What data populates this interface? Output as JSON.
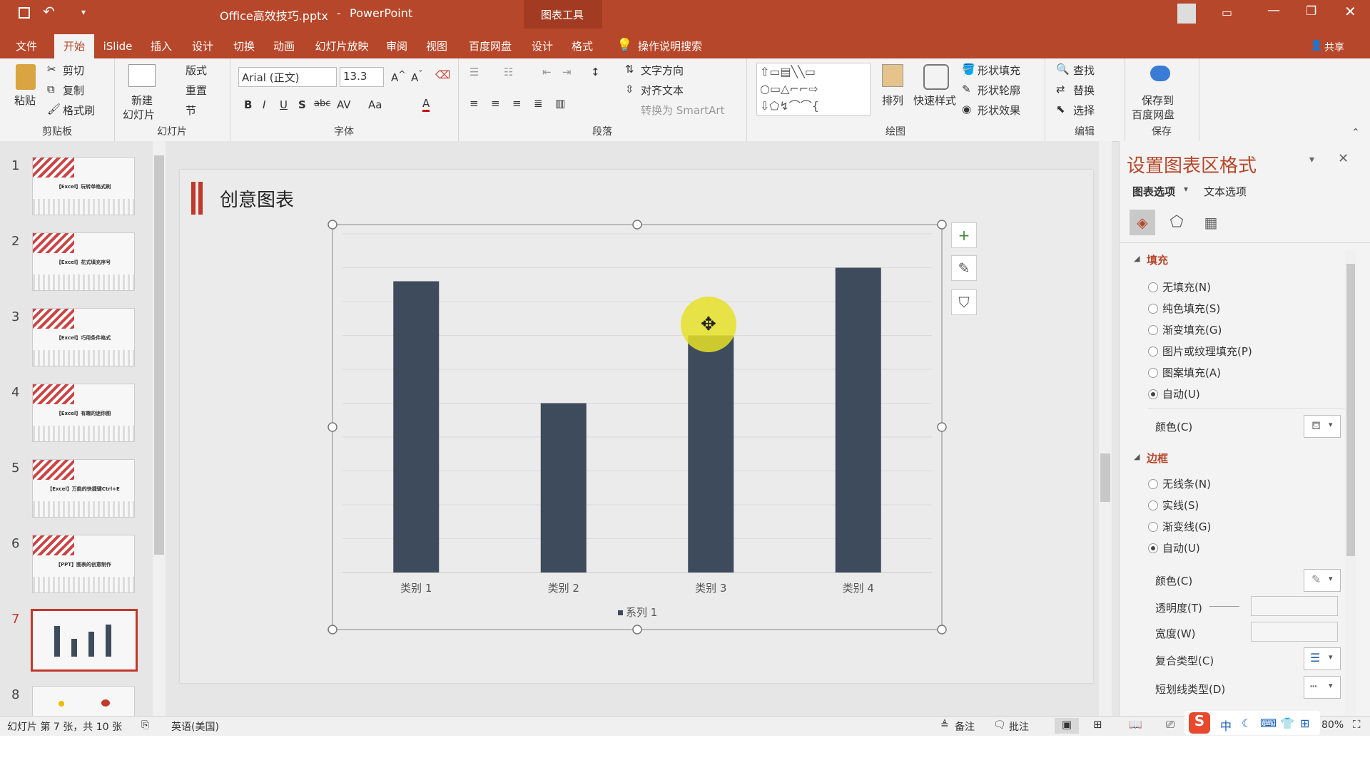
{
  "titlebar": {
    "filename": "Office高效技巧.pptx",
    "separator": "-",
    "app": "PowerPoint",
    "context_tab": "图表工具",
    "share": "共享"
  },
  "ribbon_tabs": [
    "文件",
    "开始",
    "iSlide",
    "插入",
    "设计",
    "切换",
    "动画",
    "幻灯片放映",
    "审阅",
    "视图",
    "百度网盘",
    "设计",
    "格式"
  ],
  "active_tab": "开始",
  "tell_me": "操作说明搜索",
  "ribbon": {
    "clipboard": {
      "paste": "粘贴",
      "cut": "剪切",
      "copy": "复制",
      "format_painter": "格式刷",
      "group": "剪贴板"
    },
    "slides": {
      "new_slide_1": "新建",
      "new_slide_2": "幻灯片",
      "layout": "版式",
      "reset": "重置",
      "section": "节",
      "group": "幻灯片"
    },
    "font": {
      "name": "Arial (正文)",
      "size": "13.3",
      "group": "字体",
      "bold": "B",
      "italic": "I",
      "underline": "U",
      "shadow": "S",
      "strike": "abc",
      "spacing": "AV",
      "case": "Aa",
      "color": "A"
    },
    "paragraph": {
      "text_direction": "文字方向",
      "align_text": "对齐文本",
      "smartart": "转换为 SmartArt",
      "group": "段落"
    },
    "drawing": {
      "arrange": "排列",
      "quick_styles": "快速样式",
      "shape_fill": "形状填充",
      "shape_outline": "形状轮廓",
      "shape_effects": "形状效果",
      "group": "绘图"
    },
    "editing": {
      "find": "查找",
      "replace": "替换",
      "select": "选择",
      "group": "编辑"
    },
    "save": {
      "save_to_1": "保存到",
      "save_to_2": "百度网盘",
      "group": "保存"
    }
  },
  "thumbnails": [
    {
      "num": "1",
      "title": "【Excel】玩转单格式刷"
    },
    {
      "num": "2",
      "title": "【Excel】花式填充序号"
    },
    {
      "num": "3",
      "title": "【Excel】巧用条件格式"
    },
    {
      "num": "4",
      "title": "【Excel】有趣的迷你图"
    },
    {
      "num": "5",
      "title": "【Excel】万能的快捷键Ctrl+E"
    },
    {
      "num": "6",
      "title": "【PPT】图表的创意制作"
    },
    {
      "num": "7",
      "title": ""
    },
    {
      "num": "8",
      "title": ""
    }
  ],
  "slide": {
    "title": "创意图表"
  },
  "chart_data": {
    "type": "bar",
    "categories": [
      "类别 1",
      "类别 2",
      "类别 3",
      "类别 4"
    ],
    "series": [
      {
        "name": "系列 1",
        "values": [
          4.3,
          2.5,
          3.5,
          4.5
        ]
      }
    ],
    "ylim": [
      0,
      5
    ],
    "grid": true,
    "legend": "bottom",
    "bar_color": "#3d4b5c"
  },
  "chart_buttons": {
    "add": "+",
    "style": "✎",
    "filter": "⛉"
  },
  "panel": {
    "title": "设置图表区格式",
    "tab_options": "图表选项",
    "tab_text": "文本选项",
    "fill_section": "填充",
    "fill_options": [
      "无填充(N)",
      "纯色填充(S)",
      "渐变填充(G)",
      "图片或纹理填充(P)",
      "图案填充(A)",
      "自动(U)"
    ],
    "fill_selected": 5,
    "color": "颜色(C)",
    "border_section": "边框",
    "border_options": [
      "无线条(N)",
      "实线(S)",
      "渐变线(G)",
      "自动(U)"
    ],
    "border_selected": 3,
    "border_color": "颜色(C)",
    "transparency": "透明度(T)",
    "width": "宽度(W)",
    "compound": "复合类型(C)",
    "dash": "短划线类型(D)"
  },
  "status": {
    "slide_info": "幻灯片 第 7 张，共 10 张",
    "language": "英语(美国)",
    "notes": "备注",
    "comments": "批注",
    "zoom": "80%"
  },
  "colors": {
    "accent": "#b7472a",
    "bar": "#3d4b5c",
    "selected_thumb": "#c0392b"
  }
}
